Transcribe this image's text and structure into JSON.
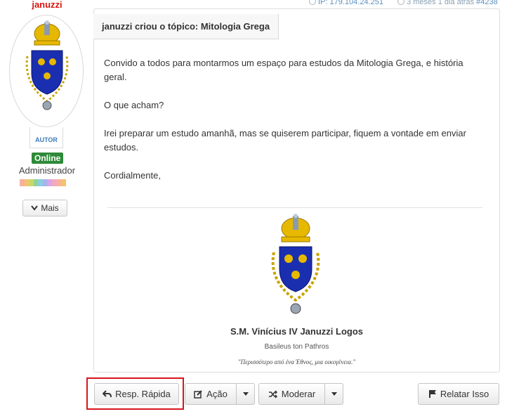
{
  "meta": {
    "ip_label": "IP: 179.104.24.251",
    "time_label": "3 meses 1 dia atrás",
    "post_id": "#4238"
  },
  "user": {
    "name": "januzzi",
    "author_tag": "AUTOR",
    "status": "Online",
    "role": "Administrador",
    "more_label": "Mais"
  },
  "post": {
    "topic_title": "januzzi criou o tópico: Mitologia Grega",
    "paragraphs": [
      "Convido a todos para montarmos um espaço para estudos da Mitologia Grega, e história geral.",
      "O que acham?",
      "Irei preparar um estudo amanhã, mas se quiserem participar, fiquem a vontade em enviar estudos.",
      "Cordialmente,"
    ]
  },
  "signature": {
    "name": "S.M. Vinícius IV Januzzi Logos",
    "subtitle": "Basileus ton Pathros",
    "motto": "\"Περισσότερο από ένα Έθνος, μια οικογένεια.\""
  },
  "actions": {
    "reply_label": "Resp. Rápida",
    "action_label": "Ação",
    "moderate_label": "Moderar",
    "report_label": "Relatar Isso"
  },
  "colors": {
    "username": "#d9150f",
    "online": "#2e8a38",
    "highlight": "#d7161d",
    "shield_blue": "#1a2fb0",
    "gold": "#e6b800"
  }
}
